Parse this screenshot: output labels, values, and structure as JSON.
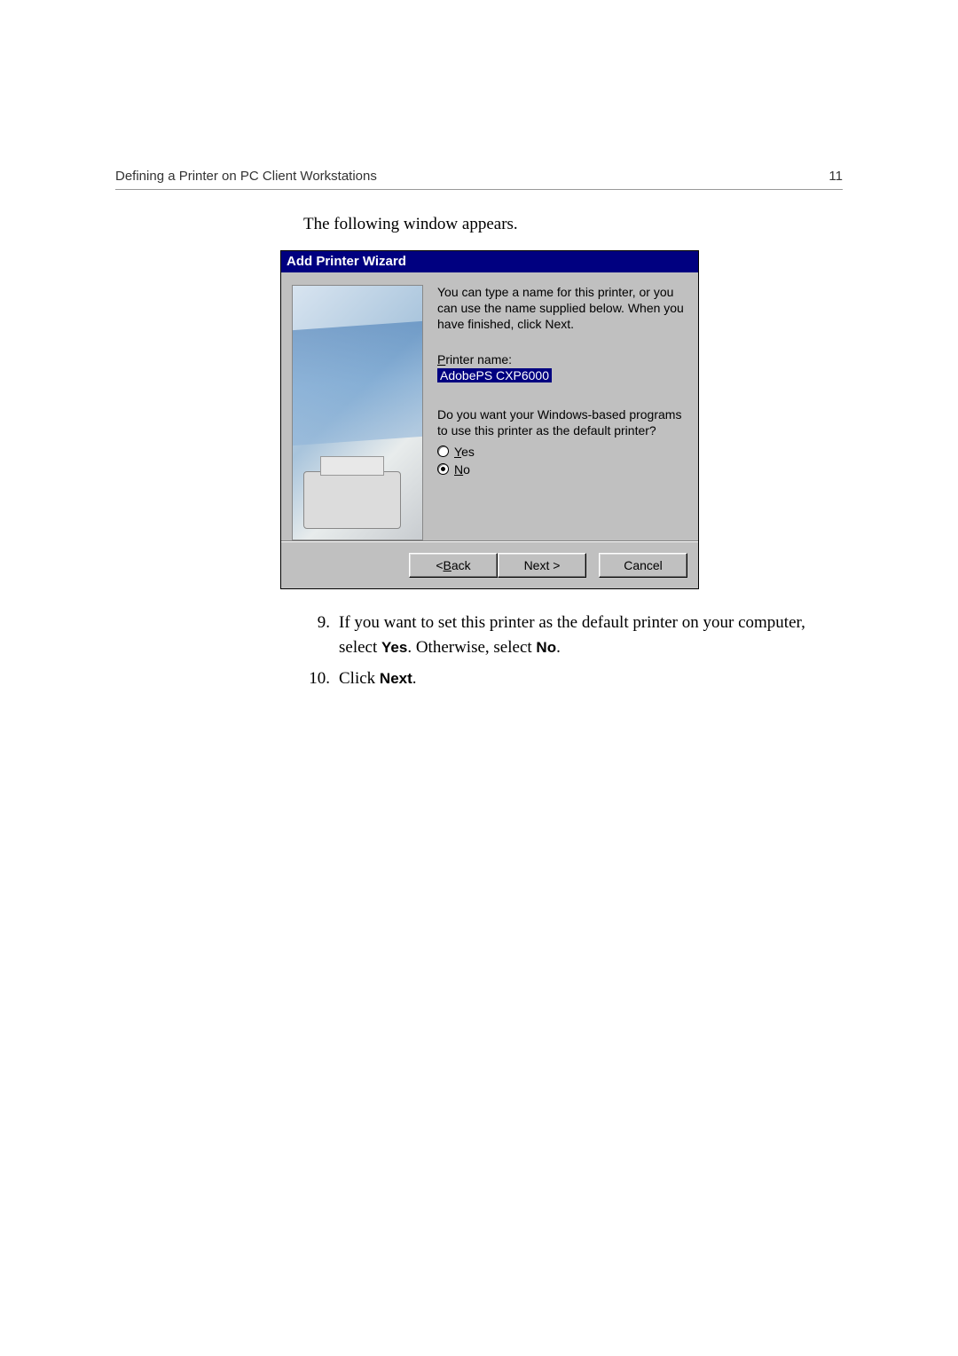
{
  "header": {
    "title": "Defining a Printer on PC Client Workstations",
    "page_number": "11"
  },
  "intro_text": "The following window appears.",
  "dialog": {
    "title": "Add Printer Wizard",
    "description": "You can type a name for this printer, or you can use the name supplied below. When you have finished, click Next.",
    "printer_name_label_pre": "P",
    "printer_name_label_post": "rinter name:",
    "printer_name_value": "AdobePS CXP6000",
    "default_question": "Do you want your Windows-based programs to use this printer as the default printer?",
    "yes_pre": "Y",
    "yes_post": "es",
    "no_pre": "N",
    "no_post": "o",
    "back_pre": "< ",
    "back_u": "B",
    "back_post": "ack",
    "next_label": "Next >",
    "cancel_label": "Cancel"
  },
  "steps": {
    "s9_num": "9.",
    "s9_a": "If you want to set this printer as the default printer on your computer, select ",
    "s9_yes": "Yes",
    "s9_b": ". Otherwise, select ",
    "s9_no": "No",
    "s9_c": ".",
    "s10_num": "10.",
    "s10_a": "Click ",
    "s10_next": "Next",
    "s10_b": "."
  }
}
